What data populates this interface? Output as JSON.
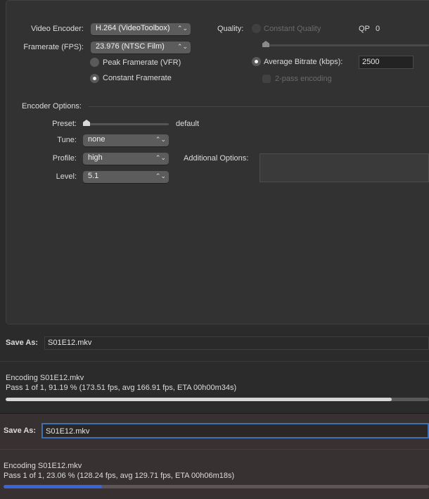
{
  "video": {
    "encoder_label": "Video Encoder:",
    "encoder_value": "H.264 (VideoToolbox)",
    "framerate_label": "Framerate (FPS):",
    "framerate_value": "23.976 (NTSC Film)",
    "peak_framerate_label": "Peak Framerate (VFR)",
    "constant_framerate_label": "Constant Framerate",
    "framerate_mode": "constant"
  },
  "quality": {
    "label": "Quality:",
    "constant_quality_label": "Constant Quality",
    "qp_label": "QP",
    "qp_value": "0",
    "average_bitrate_label": "Average Bitrate (kbps):",
    "average_bitrate_value": "2500",
    "two_pass_label": "2-pass encoding",
    "mode": "average_bitrate"
  },
  "encoder_options": {
    "header": "Encoder Options:",
    "preset_label": "Preset:",
    "preset_value": "default",
    "tune_label": "Tune:",
    "tune_value": "none",
    "profile_label": "Profile:",
    "profile_value": "high",
    "level_label": "Level:",
    "level_value": "5.1",
    "additional_label": "Additional Options:",
    "additional_value": ""
  },
  "window_top": {
    "save_as_label": "Save As:",
    "save_as_value": "S01E12.mkv",
    "status_title": "Encoding S01E12.mkv",
    "status_detail": "Pass 1 of 1, 91.19 % (173.51 fps, avg 166.91 fps, ETA 00h00m34s)",
    "progress": 0.9119,
    "progress_color": "#d6d6d6"
  },
  "window_bottom": {
    "save_as_label": "Save As:",
    "save_as_value": "S01E12.mkv",
    "status_title": "Encoding S01E12.mkv",
    "status_detail": "Pass 1 of 1, 23.06 % (128.24 fps, avg 129.71 fps, ETA 00h06m18s)",
    "progress": 0.2306,
    "progress_color": "#3d63d8",
    "focus_color": "#3f6fb5"
  },
  "icons": {
    "popup_chevron": "updown-chevron-icon",
    "slider_knob": "slider-knob-icon"
  }
}
